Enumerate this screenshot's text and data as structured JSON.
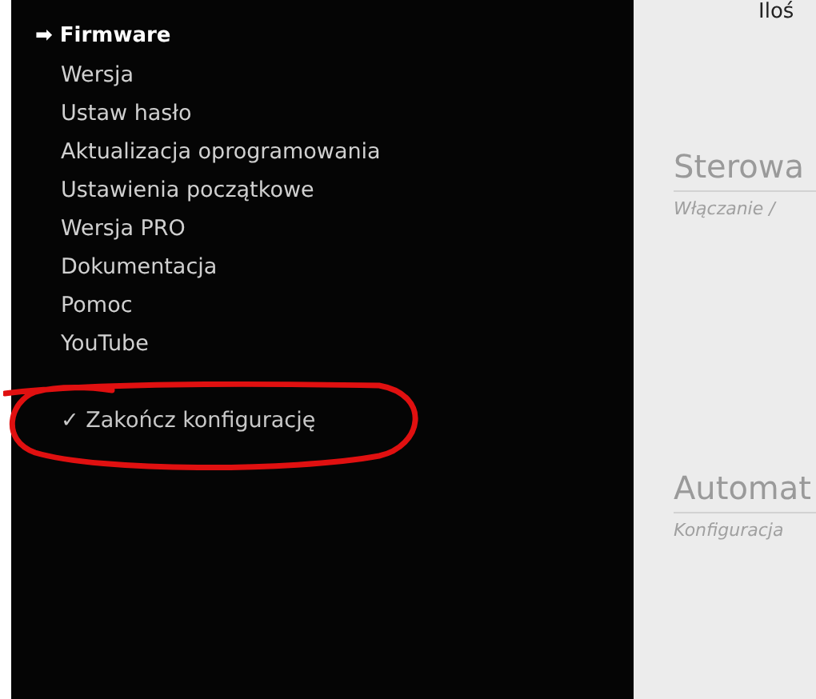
{
  "sidebar": {
    "section": {
      "icon": "➡",
      "label": "Firmware"
    },
    "items": [
      {
        "label": "Wersja"
      },
      {
        "label": "Ustaw hasło"
      },
      {
        "label": "Aktualizacja oprogramowania"
      },
      {
        "label": "Ustawienia początkowe"
      },
      {
        "label": "Wersja PRO"
      },
      {
        "label": "Dokumentacja"
      },
      {
        "label": "Pomoc"
      },
      {
        "label": "YouTube"
      }
    ],
    "finish": {
      "icon": "✓",
      "label": "Zakończ konfigurację"
    }
  },
  "content": {
    "top_text": "Iloś",
    "sections": [
      {
        "title": "Sterowa",
        "subtitle": "Włączanie /"
      },
      {
        "title": "Automat",
        "subtitle": "Konfiguracja"
      }
    ]
  }
}
